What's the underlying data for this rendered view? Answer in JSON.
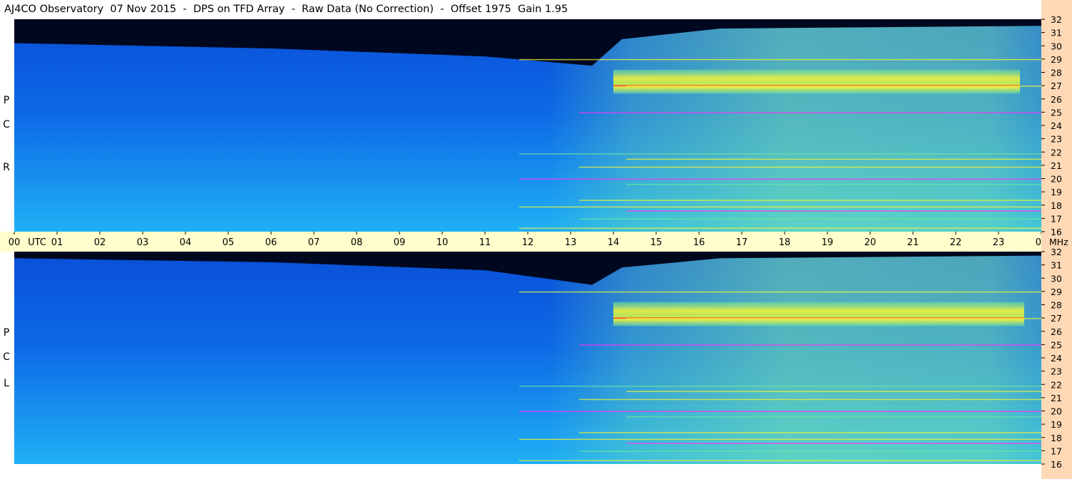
{
  "header": {
    "title": "AJ4CO Observatory  07 Nov 2015  -  DPS on TFD Array  -  Raw Data (No Correction)  -  Offset 1975  Gain 1.95"
  },
  "panels": {
    "top": {
      "label": [
        "R",
        "C",
        "P"
      ]
    },
    "bottom": {
      "label": [
        "L",
        "C",
        "P"
      ]
    }
  },
  "time_axis": {
    "unit_label": "UTC",
    "hours": [
      "00",
      "01",
      "02",
      "03",
      "04",
      "05",
      "06",
      "07",
      "08",
      "09",
      "10",
      "11",
      "12",
      "13",
      "14",
      "15",
      "16",
      "17",
      "18",
      "19",
      "20",
      "21",
      "22",
      "23",
      "00"
    ]
  },
  "freq_axis": {
    "unit_label": "MHz",
    "ticks": [
      "32",
      "31",
      "30",
      "29",
      "28",
      "27",
      "26",
      "25",
      "24",
      "23",
      "22",
      "21",
      "20",
      "19",
      "18",
      "17",
      "16"
    ]
  },
  "colors": {
    "background_blue_dark": "#000820",
    "background_blue_mid": "#0a4fd8",
    "background_blue_light": "#1fb0f5",
    "signal_green": "#6fe3a0",
    "signal_yellow": "#f2f23a",
    "signal_red": "#ff3a3a",
    "signal_magenta": "#ff2fff",
    "time_axis_bg": "#fffecc",
    "freq_axis_bg": "#ffd9b5"
  },
  "chart_data": [
    {
      "type": "heatmap",
      "title": "AJ4CO Observatory  07 Nov 2015  -  DPS on TFD Array  -  Raw Data (No Correction)  -  Offset 1975  Gain 1.95",
      "panel": "RCP",
      "xlabel": "UTC",
      "ylabel": "MHz",
      "xlim": [
        0,
        24
      ],
      "ylim": [
        16,
        32
      ],
      "x_ticks": [
        "00",
        "01",
        "02",
        "03",
        "04",
        "05",
        "06",
        "07",
        "08",
        "09",
        "10",
        "11",
        "12",
        "13",
        "14",
        "15",
        "16",
        "17",
        "18",
        "19",
        "20",
        "21",
        "22",
        "23",
        "00"
      ],
      "y_ticks": [
        32,
        31,
        30,
        29,
        28,
        27,
        26,
        25,
        24,
        23,
        22,
        21,
        20,
        19,
        18,
        17,
        16
      ],
      "ionospheric_cutoff": [
        {
          "hour": 0,
          "mhz": 30.2
        },
        {
          "hour": 6,
          "mhz": 29.8
        },
        {
          "hour": 11,
          "mhz": 29.2
        },
        {
          "hour": 13.5,
          "mhz": 28.5
        },
        {
          "hour": 14.2,
          "mhz": 30.5
        },
        {
          "hour": 16.5,
          "mhz": 31.3
        },
        {
          "hour": 24,
          "mhz": 31.5
        }
      ],
      "bright_band": {
        "hour_start": 14.0,
        "hour_end": 23.5,
        "mhz_low": 26.4,
        "mhz_high": 28.2
      },
      "interference_lines_mhz": [
        16.3,
        17.0,
        17.6,
        17.9,
        18.4,
        19.6,
        20.0,
        20.9,
        21.5,
        21.9,
        25.0,
        27.0,
        29.0
      ]
    },
    {
      "type": "heatmap",
      "panel": "LCP",
      "xlabel": "UTC",
      "ylabel": "MHz",
      "xlim": [
        0,
        24
      ],
      "ylim": [
        16,
        32
      ],
      "x_ticks": [
        "00",
        "01",
        "02",
        "03",
        "04",
        "05",
        "06",
        "07",
        "08",
        "09",
        "10",
        "11",
        "12",
        "13",
        "14",
        "15",
        "16",
        "17",
        "18",
        "19",
        "20",
        "21",
        "22",
        "23",
        "00"
      ],
      "y_ticks": [
        32,
        31,
        30,
        29,
        28,
        27,
        26,
        25,
        24,
        23,
        22,
        21,
        20,
        19,
        18,
        17,
        16
      ],
      "ionospheric_cutoff": [
        {
          "hour": 0,
          "mhz": 31.5
        },
        {
          "hour": 6,
          "mhz": 31.2
        },
        {
          "hour": 11,
          "mhz": 30.6
        },
        {
          "hour": 13.5,
          "mhz": 29.5
        },
        {
          "hour": 14.2,
          "mhz": 30.8
        },
        {
          "hour": 16.5,
          "mhz": 31.5
        },
        {
          "hour": 24,
          "mhz": 31.7
        }
      ],
      "bright_band": {
        "hour_start": 14.0,
        "hour_end": 23.6,
        "mhz_low": 26.4,
        "mhz_high": 28.2
      },
      "interference_lines_mhz": [
        16.3,
        17.0,
        17.6,
        17.9,
        18.4,
        19.6,
        20.0,
        20.9,
        21.5,
        21.9,
        25.0,
        27.0,
        29.0
      ]
    }
  ]
}
